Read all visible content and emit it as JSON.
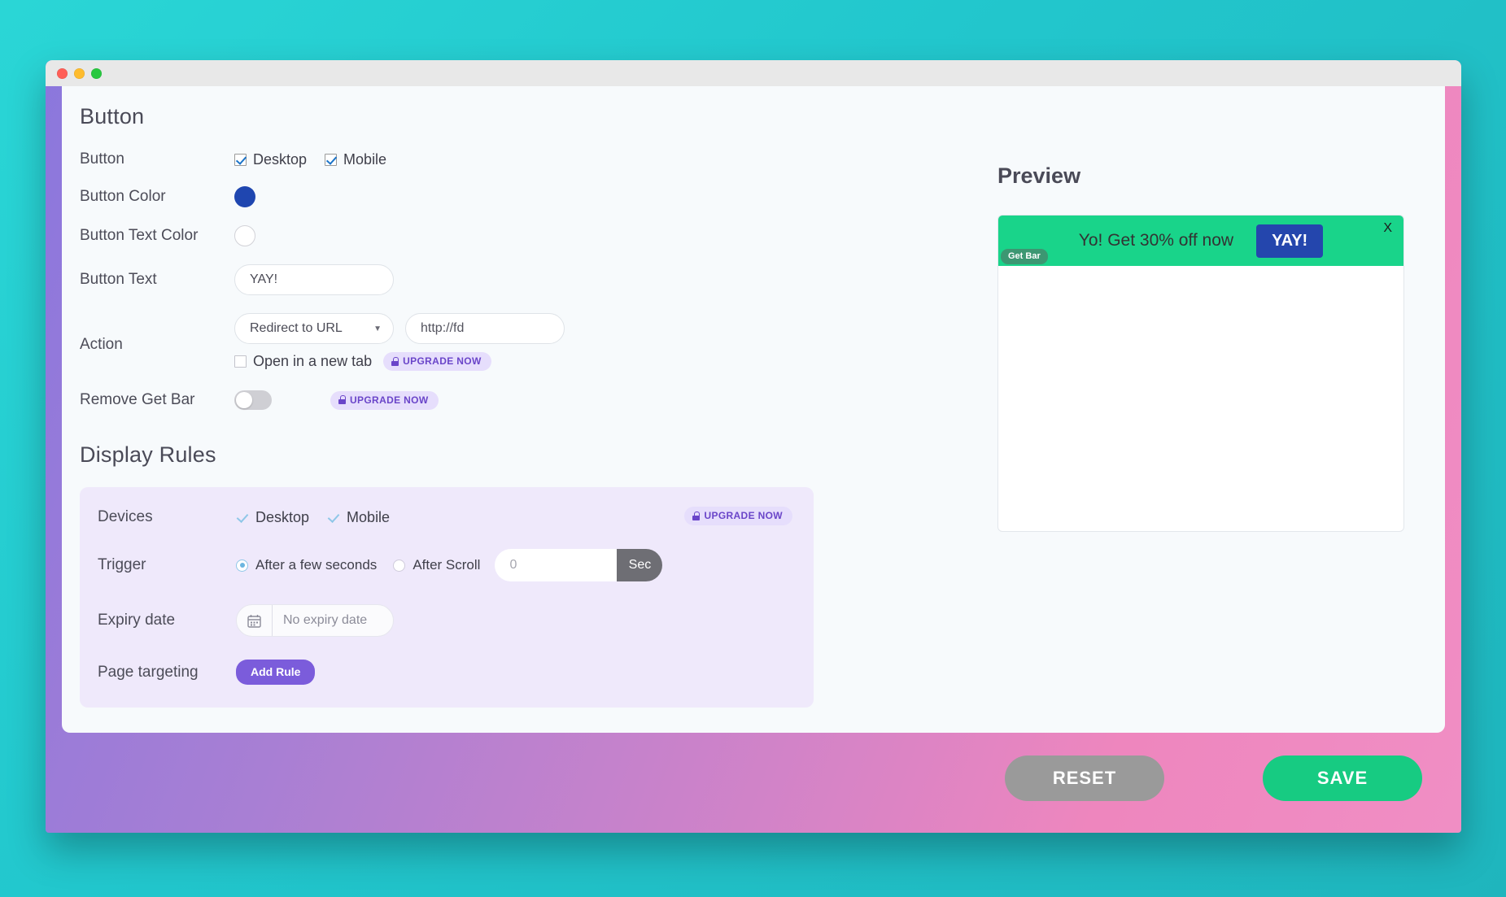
{
  "window": {
    "traffic_lights": [
      "close",
      "minimize",
      "maximize"
    ]
  },
  "button_section": {
    "title": "Button",
    "rows": {
      "button": {
        "label": "Button",
        "desktop": "Desktop",
        "mobile": "Mobile"
      },
      "button_color": {
        "label": "Button Color",
        "value": "#1f46b0"
      },
      "button_text_color": {
        "label": "Button Text Color",
        "value": "#ffffff"
      },
      "button_text": {
        "label": "Button Text",
        "value": "YAY!"
      },
      "action": {
        "label": "Action",
        "select_value": "Redirect to URL",
        "url_value": "http://fd",
        "new_tab_label": "Open in a new tab",
        "upgrade_label": "UPGRADE NOW"
      },
      "remove_get_bar": {
        "label": "Remove Get Bar",
        "toggle_state": "off",
        "upgrade_label": "UPGRADE NOW"
      }
    }
  },
  "display_rules": {
    "title": "Display Rules",
    "upgrade_label": "UPGRADE NOW",
    "devices": {
      "label": "Devices",
      "desktop": "Desktop",
      "mobile": "Mobile"
    },
    "trigger": {
      "label": "Trigger",
      "option_seconds": "After a few seconds",
      "option_scroll": "After Scroll",
      "seconds_value": "0",
      "unit": "Sec"
    },
    "expiry": {
      "label": "Expiry date",
      "placeholder": "No expiry date"
    },
    "page_targeting": {
      "label": "Page targeting",
      "add_rule": "Add Rule"
    }
  },
  "preview": {
    "title": "Preview",
    "bar": {
      "message": "Yo! Get 30% off now",
      "button_label": "YAY!",
      "close_label": "X",
      "watermark": "Get Bar",
      "bar_color": "#19d48a",
      "button_color": "#2446ad"
    }
  },
  "footer": {
    "reset_label": "RESET",
    "save_label": "SAVE"
  }
}
